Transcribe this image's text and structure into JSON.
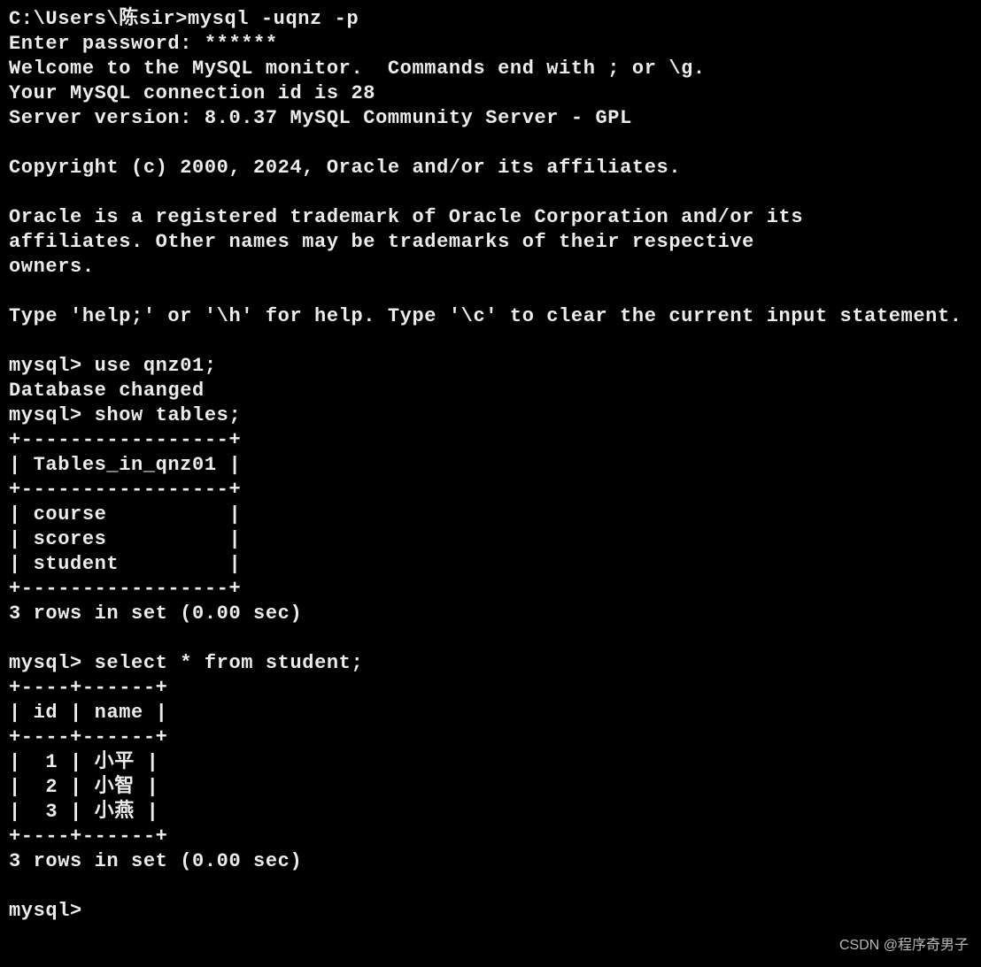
{
  "terminal": {
    "prompt1": "C:\\Users\\陈sir>",
    "cmd1": "mysql -uqnz -p",
    "line_pwd": "Enter password: ******",
    "line_welcome": "Welcome to the MySQL monitor.  Commands end with ; or \\g.",
    "line_connection": "Your MySQL connection id is 28",
    "line_server": "Server version: 8.0.37 MySQL Community Server - GPL",
    "line_copyright": "Copyright (c) 2000, 2024, Oracle and/or its affiliates.",
    "line_oracle1": "Oracle is a registered trademark of Oracle Corporation and/or its",
    "line_oracle2": "affiliates. Other names may be trademarks of their respective",
    "line_oracle3": "owners.",
    "line_help": "Type 'help;' or '\\h' for help. Type '\\c' to clear the current input statement.",
    "mysql_prompt": "mysql> ",
    "cmd_use": "use qnz01;",
    "line_db_changed": "Database changed",
    "cmd_show": "show tables;",
    "tables_in_qnz01": {
      "header": "Tables_in_qnz01",
      "rows": [
        "course",
        "scores",
        "student"
      ],
      "summary": "3 rows in set (0.00 sec)"
    },
    "cmd_select": "select * from student;",
    "student_table": {
      "col1": "id",
      "col2": "name",
      "rows": [
        {
          "id": "1",
          "name": "小平"
        },
        {
          "id": "2",
          "name": "小智"
        },
        {
          "id": "3",
          "name": "小燕"
        }
      ],
      "summary": "3 rows in set (0.00 sec)"
    }
  },
  "watermark": "CSDN @程序奇男子"
}
